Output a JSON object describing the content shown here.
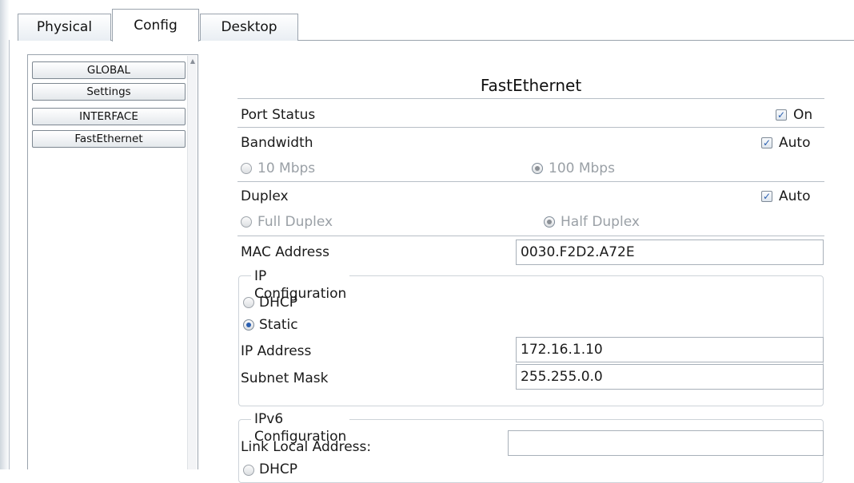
{
  "tabs": [
    {
      "label": "Physical"
    },
    {
      "label": "Config",
      "active": true
    },
    {
      "label": "Desktop"
    }
  ],
  "sidebar": {
    "items": [
      {
        "label": "GLOBAL"
      },
      {
        "label": "Settings"
      },
      {
        "label": "INTERFACE"
      },
      {
        "label": "FastEthernet",
        "selected": true
      }
    ]
  },
  "panel": {
    "title": "FastEthernet",
    "port_status": {
      "label": "Port Status",
      "checkbox_label": "On",
      "checked": true
    },
    "bandwidth": {
      "label": "Bandwidth",
      "auto_label": "Auto",
      "auto_checked": true,
      "options": [
        {
          "label": "10 Mbps",
          "selected": false
        },
        {
          "label": "100 Mbps",
          "selected": true
        }
      ]
    },
    "duplex": {
      "label": "Duplex",
      "auto_label": "Auto",
      "auto_checked": true,
      "options": [
        {
          "label": "Full Duplex",
          "selected": false
        },
        {
          "label": "Half Duplex",
          "selected": true
        }
      ]
    },
    "mac": {
      "label": "MAC Address",
      "value": "0030.F2D2.A72E"
    },
    "ip_config": {
      "title": "IP Configuration",
      "dhcp_label": "DHCP",
      "static_label": "Static",
      "mode": "Static",
      "ip_label": "IP Address",
      "ip_value": "172.16.1.10",
      "mask_label": "Subnet Mask",
      "mask_value": "255.255.0.0"
    },
    "ipv6_config": {
      "title": "IPv6 Configuration",
      "link_local_label": "Link Local Address:",
      "link_local_value": "",
      "dhcp_label": "DHCP"
    }
  },
  "icons": {
    "check": "✓",
    "scroll_up": "▲"
  },
  "colors": {
    "accent": "#2a5fb0",
    "border": "#9aa3ad"
  }
}
